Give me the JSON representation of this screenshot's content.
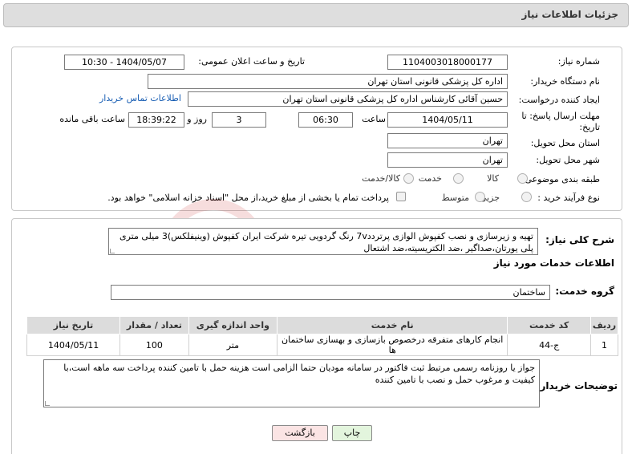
{
  "header": {
    "title": "جزئیات اطلاعات نیاز"
  },
  "form": {
    "need_number_label": "شماره نیاز:",
    "need_number": "1104003018000177",
    "announce_label": "تاریخ و ساعت اعلان عمومی:",
    "announce_value": "1404/05/07 - 10:30",
    "buyer_org_label": "نام دستگاه خریدار:",
    "buyer_org": "اداره کل پزشکی قانونی استان تهران",
    "creator_label": "ایجاد کننده درخواست:",
    "creator": "حسین آقائی کارشناس اداره کل پزشکی قانونی استان تهران",
    "contact_link": "اطلاعات تماس خریدار",
    "deadline_label_1": "مهلت ارسال پاسخ: تا",
    "deadline_label_2": "تاریخ:",
    "deadline_date": "1404/05/11",
    "time_label": "ساعت",
    "deadline_time": "06:30",
    "days_value": "3",
    "days_label": "روز و",
    "remaining_time": "18:39:22",
    "remaining_label": "ساعت باقی مانده",
    "province_label": "استان محل تحویل:",
    "province": "تهران",
    "city_label": "شهر محل تحویل:",
    "city": "تهران",
    "category_label": "طبقه بندی موضوعی:",
    "category_options": [
      "کالا",
      "خدمت",
      "کالا/خدمت"
    ],
    "process_label": "نوع فرآیند خرید :",
    "process_options": [
      "جزیی",
      "متوسط"
    ],
    "payment_note": "پرداخت تمام یا بخشی از مبلغ خرید،از محل \"اسناد خزانه اسلامی\" خواهد بود."
  },
  "description": {
    "label": "شرح کلی نیاز:",
    "text": "تهیه و زیرسازی و نصب کفپوش الوازی پرتردد7v رنگ گردویی تیره شرکت ایران کفپوش (وینیفلکس)3 میلی متری پلی یورتان،صداگیر ،ضد الکتریسیته،ضد اشتعال"
  },
  "services": {
    "section_title": "اطلاعات خدمات مورد نیاز",
    "group_label": "گروه خدمت:",
    "group_value": "ساختمان",
    "columns": [
      "ردیف",
      "کد خدمت",
      "نام خدمت",
      "واحد اندازه گیری",
      "تعداد / مقدار",
      "تاریخ نیاز"
    ],
    "rows": [
      {
        "index": "1",
        "code": "ج-44",
        "name": "انجام کارهای متفرقه درخصوص بازسازی و بهسازی ساختمان ها",
        "unit": "متر",
        "qty": "100",
        "date": "1404/05/11"
      }
    ]
  },
  "buyer_notes": {
    "label": "توضیحات خریدار:",
    "text": "جواز یا روزنامه رسمی مرتبط ثبت فاکتور در سامانه مودیان حتما الزامی است هزینه حمل با تامین کننده پرداخت سه ماهه است،با کیفیت و مرغوب حمل و نصب با تامین کننده"
  },
  "buttons": {
    "print": "چاپ",
    "back": "بازگشت"
  },
  "colors": {
    "link": "#1a5fb4",
    "print_bg": "#e3f5dd",
    "back_bg": "#fbe4e4",
    "header_bg": "#dedede"
  }
}
